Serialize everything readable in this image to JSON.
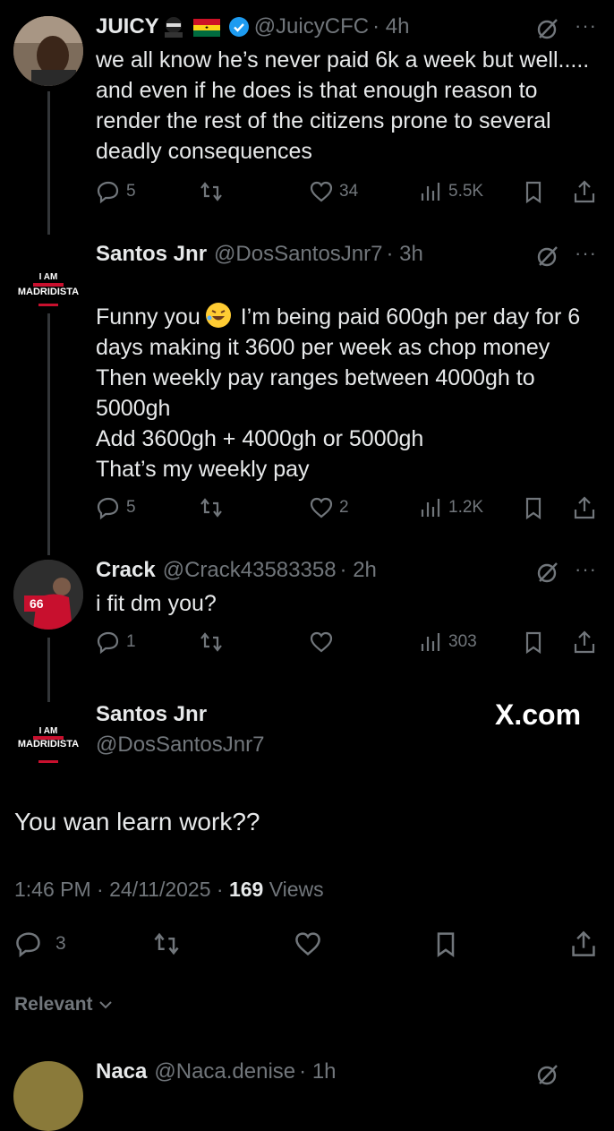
{
  "replies": [
    {
      "name": "JUICY",
      "handle": "@JuicyCFC",
      "time": "· 4h",
      "text": "we all know he’s never paid 6k a week but well..... and even if he does is that enough reason to render the rest of the citizens prone to several deadly consequences",
      "replies": "5",
      "reposts": "",
      "likes": "34",
      "views": "5.5K"
    },
    {
      "name": "Santos Jnr",
      "handle": "@DosSantosJnr7",
      "time": "· 3h",
      "avatar_text": [
        "I AM",
        "MADRIDISTA"
      ],
      "text_before": "Funny you",
      "text_after": " I’m being paid 600gh per day for 6 days making it 3600 per week as chop money\nThen weekly pay ranges between 4000gh to 5000gh\nAdd 3600gh + 4000gh or 5000gh\nThat’s my weekly pay",
      "replies": "5",
      "reposts": "",
      "likes": "2",
      "views": "1.2K"
    },
    {
      "name": "Crack",
      "handle": "@Crack43583358",
      "time": "· 2h",
      "avatar_number": "66",
      "text": "i fit dm you?",
      "replies": "1",
      "reposts": "",
      "likes": "",
      "views": "303"
    }
  ],
  "main_post": {
    "name": "Santos Jnr",
    "handle": "@DosSantosJnr7",
    "avatar_text": [
      "I AM",
      "MADRIDISTA"
    ],
    "watermark": "X.com",
    "text": "You wan learn work??",
    "time": "1:46 PM",
    "date": "24/11/2025",
    "views_count": "169",
    "views_label": "Views",
    "replies": "3"
  },
  "sort_label": "Relevant",
  "next_reply_partial": {
    "name": "Naca",
    "handle": "@Naca.denise",
    "time": "· 1h"
  },
  "colors": {
    "background": "#000000",
    "text": "#e7e9ea",
    "muted": "#71767b",
    "verified": "#1d9bf0",
    "thread_line": "#333639"
  }
}
